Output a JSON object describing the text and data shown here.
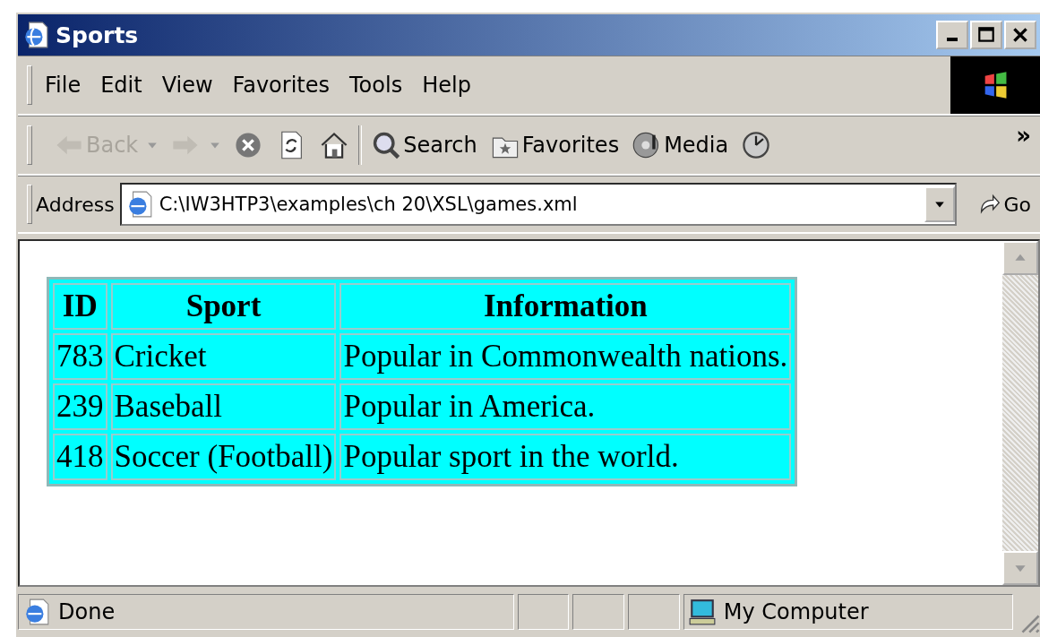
{
  "window": {
    "title": "Sports"
  },
  "menu": [
    "File",
    "Edit",
    "View",
    "Favorites",
    "Tools",
    "Help"
  ],
  "toolbar": [
    {
      "kind": "back",
      "label": "Back",
      "disabled": true,
      "dropdown": true
    },
    {
      "kind": "forward",
      "disabled": true,
      "dropdown": true
    },
    {
      "kind": "stop",
      "disabled": false,
      "dropdown": false
    },
    {
      "kind": "refresh",
      "disabled": false,
      "dropdown": false
    },
    {
      "kind": "home",
      "disabled": false,
      "dropdown": false
    },
    {
      "kind": "separator"
    },
    {
      "kind": "search",
      "label": "Search",
      "disabled": false,
      "dropdown": false
    },
    {
      "kind": "favorites",
      "label": "Favorites",
      "disabled": false,
      "dropdown": false
    },
    {
      "kind": "media",
      "label": "Media",
      "disabled": false,
      "dropdown": false
    },
    {
      "kind": "history",
      "disabled": false,
      "dropdown": false
    }
  ],
  "toolbar_more": "»",
  "address": {
    "label": "Address",
    "value": "C:\\IW3HTP3\\examples\\ch 20\\XSL\\games.xml",
    "go": "Go"
  },
  "table": {
    "columns": [
      "ID",
      "Sport",
      "Information"
    ],
    "rows": [
      [
        "783",
        "Cricket",
        "Popular in Commonwealth nations."
      ],
      [
        "239",
        "Baseball",
        "Popular in America."
      ],
      [
        "418",
        "Soccer (Football)",
        "Popular sport in the world."
      ]
    ]
  },
  "status_bar": {
    "text": "Done",
    "zone": "My Computer"
  }
}
